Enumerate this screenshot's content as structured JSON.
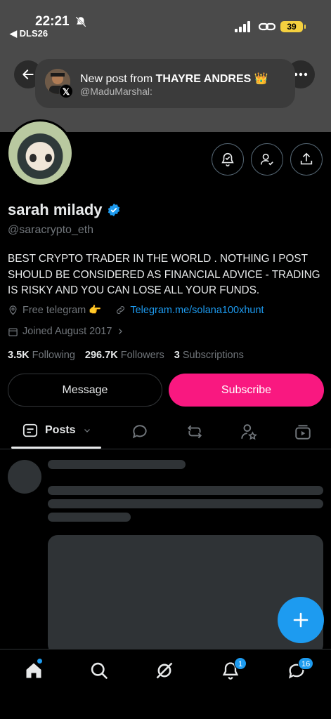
{
  "status_bar": {
    "time": "22:21",
    "back_app": "◀ DLS26",
    "battery": "39"
  },
  "notification": {
    "prefix": "New post from ",
    "name": "THAYRE ANDRES 👑",
    "handle": "@MaduMarshal:"
  },
  "profile": {
    "name": "sarah milady",
    "handle": "@saracrypto_eth",
    "bio": "BEST CRYPTO TRADER IN THE WORLD . NOTHING I POST SHOULD BE CONSIDERED AS FINANCIAL ADVICE - TRADING IS RISKY AND YOU CAN LOSE ALL YOUR FUNDS.",
    "location": "Free telegram 👉",
    "website": "Telegram.me/solana100xhunt",
    "joined": "Joined August 2017",
    "following_count": "3.5K",
    "following_label": "Following",
    "followers_count": "296.7K",
    "followers_label": "Followers",
    "subscriptions_count": "3",
    "subscriptions_label": "Subscriptions"
  },
  "actions": {
    "message_label": "Message",
    "subscribe_label": "Subscribe"
  },
  "tabs": {
    "posts_label": "Posts"
  },
  "bottom_nav": {
    "notifications_badge": "1",
    "messages_badge": "16"
  },
  "colors": {
    "accent": "#1d9bf0",
    "subscribe": "#f91880",
    "battery": "#f4d03f"
  }
}
